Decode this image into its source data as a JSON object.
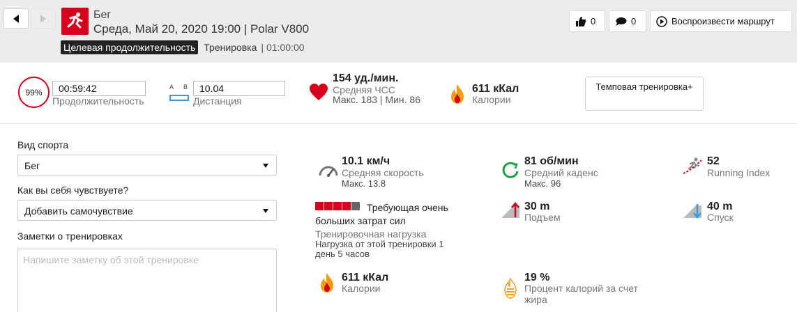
{
  "header": {
    "sport_title": "Бег",
    "session_subtitle": "Среда, Май 20, 2020 19:00 | Polar V800",
    "target_badge": "Целевая продолжительность",
    "target_kind": "Тренировка",
    "target_sep": "|",
    "target_time": "01:00:00",
    "like_count": "0",
    "comment_count": "0",
    "replay_label": "Воспроизвести маршрут"
  },
  "summary": {
    "completion": "99%",
    "duration_value": "00:59:42",
    "duration_caption": "Продолжительность",
    "distance_a": "A",
    "distance_b": "B",
    "distance_value": "10.04",
    "distance_caption": "Дистанция",
    "hr_value": "154 уд./мин.",
    "hr_caption": "Средняя ЧСС",
    "hr_minmax": "Макс. 183  |  Мин. 86",
    "calories_value": "611 кКал",
    "calories_caption": "Калории",
    "tempo_label": "Темповая тренировка+"
  },
  "form": {
    "sport_label": "Вид спорта",
    "sport_value": "Бег",
    "feeling_label": "Как вы себя чувствуете?",
    "feeling_value": "Добавить самочувствие",
    "notes_label": "Заметки о тренировках",
    "notes_placeholder": "Напишите заметку об этой тренировке"
  },
  "stats": {
    "speed_value": "10.1 км/ч",
    "speed_caption": "Средняя скорость",
    "speed_max": "Макс. 13.8",
    "cadence_value": "81 об/мин",
    "cadence_caption": "Средний каденс",
    "cadence_max": "Макс. 96",
    "running_index_value": "52",
    "running_index_caption": "Running Index",
    "load_level": 4,
    "load_total": 5,
    "load_value": "Требующая очень больших затрат сил",
    "load_caption": "Тренировочная нагрузка",
    "load_detail": "Нагрузка от этой тренировки 1 день 5 часов",
    "ascent_value": "30 m",
    "ascent_caption": "Подъем",
    "descent_value": "40 m",
    "descent_caption": "Спуск",
    "calories_value": "611 кКал",
    "calories_caption": "Калории",
    "fat_value": "19 %",
    "fat_caption": "Процент калорий за счет жира"
  },
  "colors": {
    "accent": "#d7001c",
    "load_on": "#d7001c",
    "load_off": "#666666",
    "distance_icon": "#3a9bd8",
    "cadence_icon": "#1aa33a"
  },
  "icons": {
    "back": "chevron-left-icon",
    "forward": "chevron-right-icon",
    "sport": "running-icon",
    "like": "thumbs-up-icon",
    "comment": "comment-icon",
    "replay": "play-icon",
    "heart": "heart-icon",
    "flame": "flame-icon",
    "speed": "speedometer-icon",
    "cadence": "cadence-icon",
    "running_index": "running-index-icon",
    "ascent": "ascent-icon",
    "descent": "descent-icon",
    "fat": "fat-burn-icon"
  }
}
